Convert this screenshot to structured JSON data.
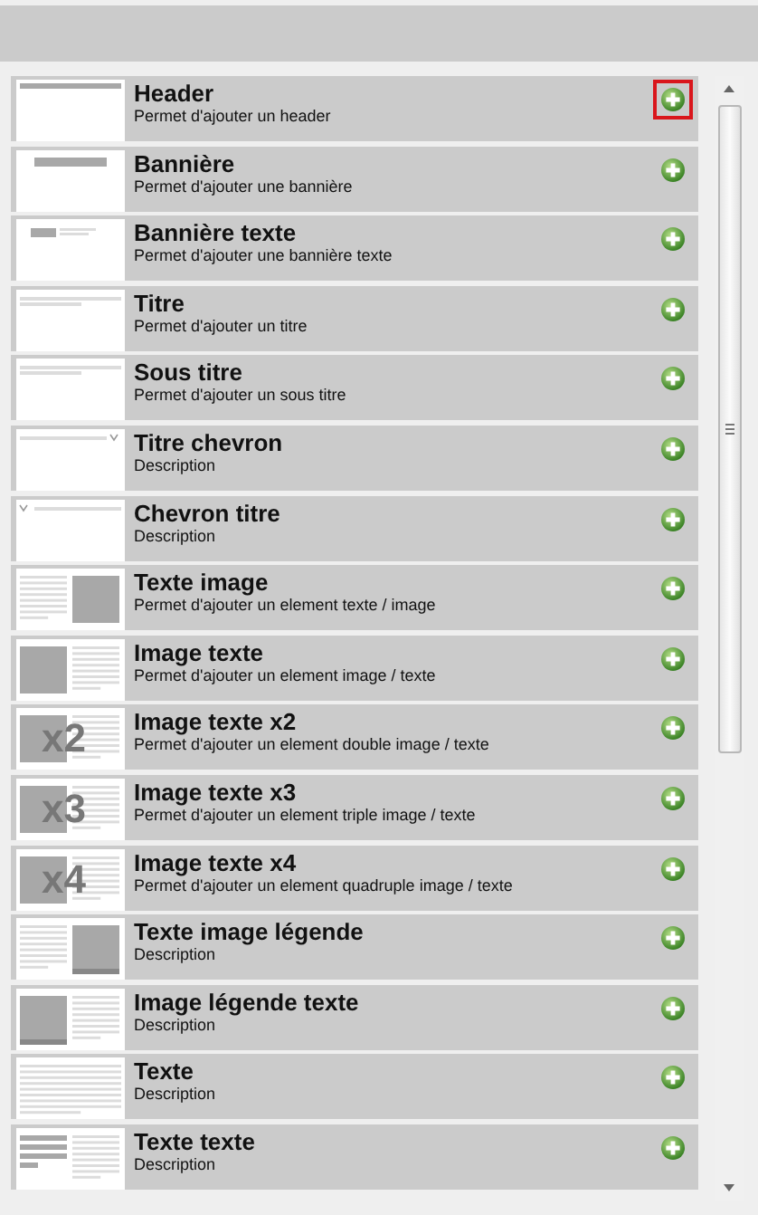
{
  "blocks": [
    {
      "title": "Header",
      "description": "Permet d'ajouter un header",
      "thumbnail": {
        "kind": "header"
      },
      "highlighted": true
    },
    {
      "title": "Bannière",
      "description": "Permet d'ajouter une bannière",
      "thumbnail": {
        "kind": "banner"
      },
      "highlighted": false
    },
    {
      "title": "Bannière texte",
      "description": "Permet d'ajouter une bannière texte",
      "thumbnail": {
        "kind": "banner-text"
      },
      "highlighted": false
    },
    {
      "title": "Titre",
      "description": "Permet d'ajouter un titre",
      "thumbnail": {
        "kind": "title"
      },
      "highlighted": false
    },
    {
      "title": "Sous titre",
      "description": "Permet d'ajouter un sous titre",
      "thumbnail": {
        "kind": "title"
      },
      "highlighted": false
    },
    {
      "title": "Titre chevron",
      "description": "Description",
      "thumbnail": {
        "kind": "title-chevron"
      },
      "highlighted": false
    },
    {
      "title": "Chevron titre",
      "description": "Description",
      "thumbnail": {
        "kind": "chevron-title"
      },
      "highlighted": false
    },
    {
      "title": "Texte image",
      "description": "Permet d'ajouter un element texte / image",
      "thumbnail": {
        "kind": "text-image"
      },
      "highlighted": false
    },
    {
      "title": "Image texte",
      "description": "Permet d'ajouter un element image / texte",
      "thumbnail": {
        "kind": "image-text"
      },
      "highlighted": false
    },
    {
      "title": "Image texte x2",
      "description": "Permet d'ajouter un element double image / texte",
      "thumbnail": {
        "kind": "image-multi",
        "label": "x2"
      },
      "highlighted": false
    },
    {
      "title": "Image texte x3",
      "description": "Permet d'ajouter un element triple image / texte",
      "thumbnail": {
        "kind": "image-multi",
        "label": "x3"
      },
      "highlighted": false
    },
    {
      "title": "Image texte x4",
      "description": "Permet d'ajouter un element quadruple image / texte",
      "thumbnail": {
        "kind": "image-multi",
        "label": "x4"
      },
      "highlighted": false
    },
    {
      "title": "Texte image légende",
      "description": "Description",
      "thumbnail": {
        "kind": "text-image-caption"
      },
      "highlighted": false
    },
    {
      "title": "Image légende texte",
      "description": "Description",
      "thumbnail": {
        "kind": "image-caption-text"
      },
      "highlighted": false
    },
    {
      "title": "Texte",
      "description": "Description",
      "thumbnail": {
        "kind": "text"
      },
      "highlighted": false
    },
    {
      "title": "Texte texte",
      "description": "Description",
      "thumbnail": {
        "kind": "text-text"
      },
      "highlighted": false
    }
  ]
}
